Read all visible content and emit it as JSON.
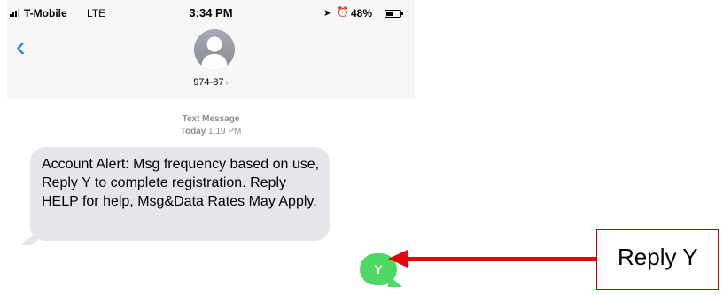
{
  "status_bar": {
    "carrier": "T-Mobile",
    "network": "LTE",
    "time": "3:34 PM",
    "battery_percent": "48%",
    "battery_level": 0.48
  },
  "header": {
    "contact_name": "974-87",
    "contact_chevron": "›",
    "back_icon": "‹"
  },
  "thread": {
    "meta_label": "Text Message",
    "meta_day": "Today",
    "meta_time": "1:19 PM",
    "incoming_message": "Account Alert: Msg frequency based on use, Reply Y to complete registration. Reply HELP for help, Msg&Data Rates May Apply.",
    "reply_message": "Y"
  },
  "annotation": {
    "callout_text": "Reply Y",
    "arrow_color": "#e8000b"
  },
  "colors": {
    "ios_blue": "#1a7cf5",
    "incoming_bubble": "#e5e5ea",
    "outgoing_bubble": "#4cd964"
  }
}
